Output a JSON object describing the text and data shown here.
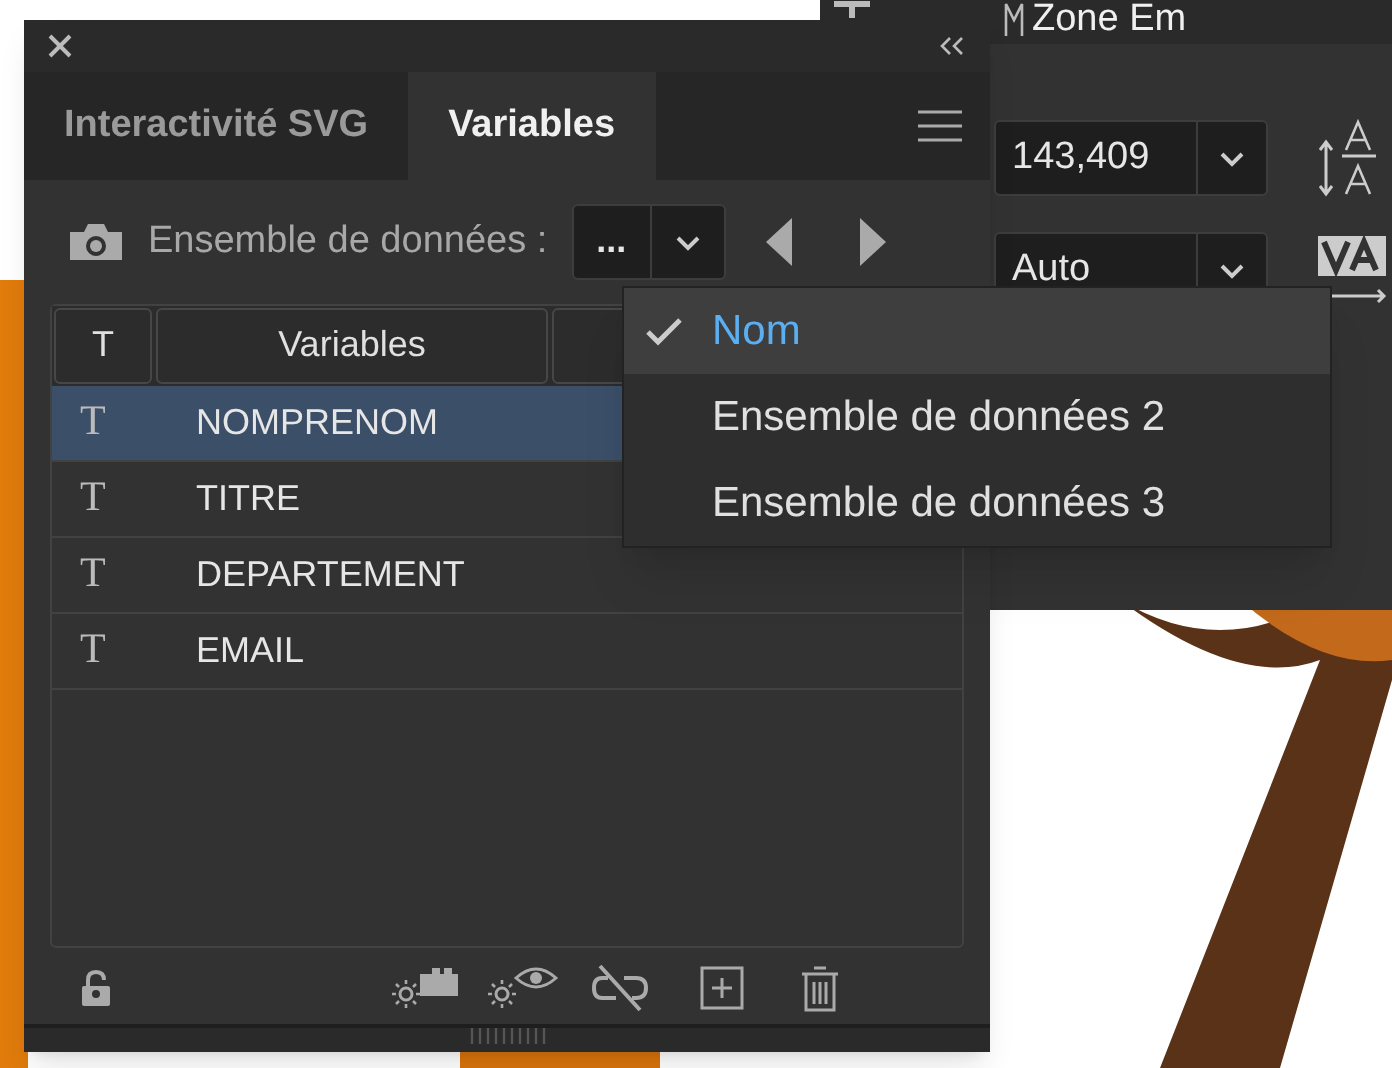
{
  "background_panel": {
    "title": "Zone Em",
    "fields": [
      {
        "value": "143,409"
      },
      {
        "value": "Auto"
      }
    ]
  },
  "panel": {
    "tabs": [
      {
        "label": "Interactivité SVG",
        "selected": false
      },
      {
        "label": "Variables",
        "selected": true
      }
    ],
    "dataset": {
      "label": "Ensemble de données :",
      "value": "..."
    },
    "table": {
      "columns": [
        "T",
        "Variables"
      ],
      "rows": [
        {
          "type_icon": "T",
          "name": "NOMPRENOM",
          "selected": true
        },
        {
          "type_icon": "T",
          "name": "TITRE",
          "selected": false
        },
        {
          "type_icon": "T",
          "name": "DEPARTEMENT",
          "selected": false
        },
        {
          "type_icon": "T",
          "name": "EMAIL",
          "selected": false
        }
      ]
    }
  },
  "dataset_menu": {
    "items": [
      {
        "label": "Nom",
        "selected": true
      },
      {
        "label": "Ensemble de données 2",
        "selected": false
      },
      {
        "label": "Ensemble de données 3",
        "selected": false
      }
    ]
  }
}
